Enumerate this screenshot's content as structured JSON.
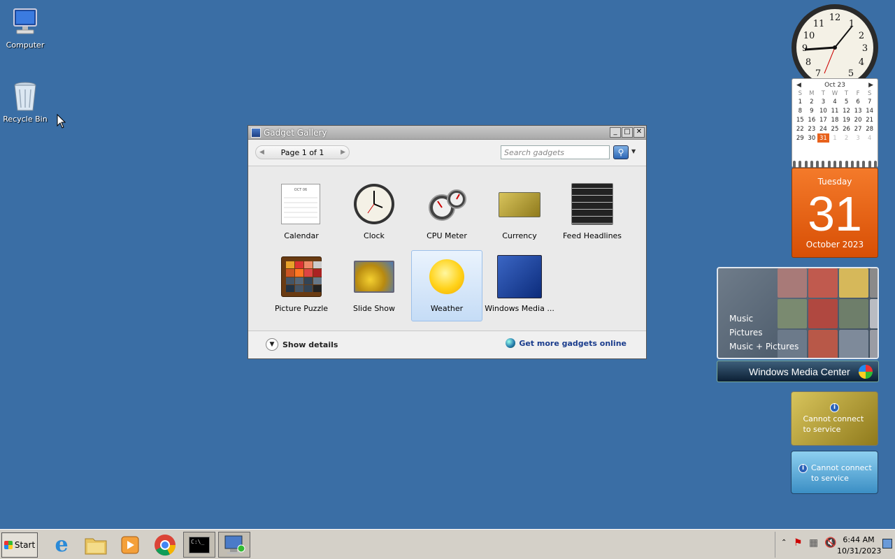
{
  "desktop": {
    "icons": [
      {
        "label": "Computer"
      },
      {
        "label": "Recycle Bin"
      }
    ]
  },
  "gadget_gallery": {
    "title": "Gadget Gallery",
    "page_label": "Page 1 of 1",
    "search_placeholder": "Search gadgets",
    "gadgets": [
      {
        "name": "Calendar"
      },
      {
        "name": "Clock"
      },
      {
        "name": "CPU Meter"
      },
      {
        "name": "Currency"
      },
      {
        "name": "Feed Headlines"
      },
      {
        "name": "Picture Puzzle"
      },
      {
        "name": "Slide Show"
      },
      {
        "name": "Weather",
        "selected": true
      },
      {
        "name": "Windows Media ..."
      }
    ],
    "show_details": "Show details",
    "get_more": "Get more gadgets online",
    "thumb_calendar_month": "OCT 06"
  },
  "calendar_gadget": {
    "month_label": "Oct 23",
    "weekdays": [
      "S",
      "M",
      "T",
      "W",
      "T",
      "F",
      "S"
    ],
    "weeks": [
      [
        "1",
        "2",
        "3",
        "4",
        "5",
        "6",
        "7"
      ],
      [
        "8",
        "9",
        "10",
        "11",
        "12",
        "13",
        "14"
      ],
      [
        "15",
        "16",
        "17",
        "18",
        "19",
        "20",
        "21"
      ],
      [
        "22",
        "23",
        "24",
        "25",
        "26",
        "27",
        "28"
      ],
      [
        "29",
        "30",
        "31",
        "1",
        "2",
        "3",
        "4"
      ]
    ],
    "today": "31"
  },
  "date_gadget": {
    "weekday": "Tuesday",
    "day": "31",
    "month_year": "October 2023"
  },
  "media_center": {
    "menu": [
      "Music",
      "Pictures",
      "Music + Pictures"
    ],
    "brand": "Windows Media Center"
  },
  "currency_gadget": {
    "message": "Cannot connect to service"
  },
  "feed_gadget": {
    "message": "Cannot connect to service"
  },
  "taskbar": {
    "start_label": "Start",
    "apps": [
      "internet-explorer",
      "windows-explorer",
      "media-player",
      "chrome",
      "command-prompt",
      "remote-desktop"
    ],
    "time": "6:44 AM",
    "date": "10/31/2023"
  },
  "colors": {
    "desktop": "#3a6ea5",
    "date_gadget": "#e8621c"
  }
}
